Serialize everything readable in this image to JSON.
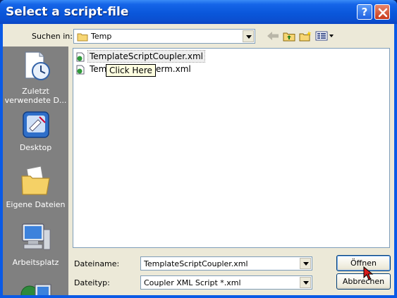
{
  "window": {
    "title": "Select a script-file"
  },
  "lookin": {
    "label": "Suchen in:",
    "value": "Temp"
  },
  "places": [
    {
      "label": "Zuletzt verwendete D..."
    },
    {
      "label": "Desktop"
    },
    {
      "label": "Eigene Dateien"
    },
    {
      "label": "Arbeitsplatz"
    }
  ],
  "files": [
    {
      "name": "TemplateScriptCoupler.xml"
    },
    {
      "name": "TemplateScriptTerm.xml",
      "visible_prefix": "Temp",
      "visible_suffix": "erm.xml"
    }
  ],
  "tooltip": {
    "text": "Click Here"
  },
  "filename": {
    "label": "Dateiname:",
    "value": "TemplateScriptCoupler.xml"
  },
  "filetype": {
    "label": "Dateityp:",
    "value": "Coupler XML Script *.xml"
  },
  "buttons": {
    "open": "Öffnen",
    "cancel": "Abbrechen",
    "help": "?"
  },
  "colors": {
    "titlebar": "#0a57db",
    "dialog": "#ece9d8",
    "places_bar": "#808080",
    "border": "#7f9db9"
  }
}
